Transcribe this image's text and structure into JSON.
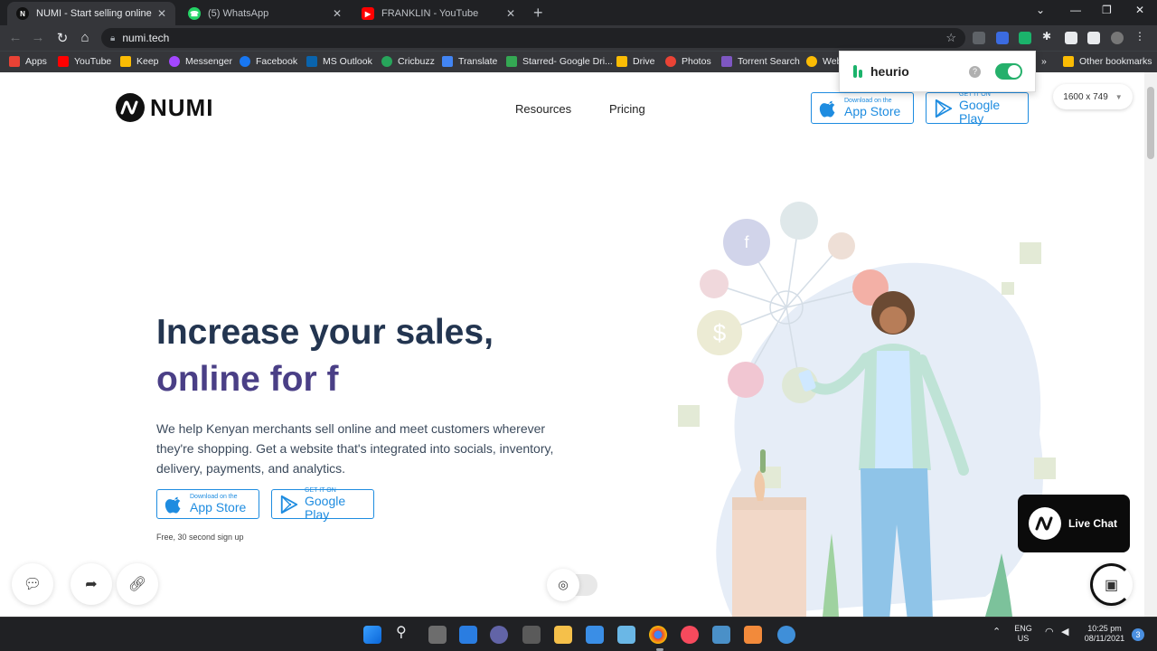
{
  "browser": {
    "tabs": [
      {
        "title": "NUMI - Start selling online for fre",
        "active": true,
        "favicon_color": "#111111"
      },
      {
        "title": "(5) WhatsApp",
        "active": false,
        "favicon_color": "#25d366"
      },
      {
        "title": "FRANKLIN - YouTube",
        "active": false,
        "favicon_color": "#ff0000"
      }
    ],
    "address": "numi.tech",
    "bookmarks": [
      {
        "label": "Apps",
        "color": "#e94235"
      },
      {
        "label": "YouTube",
        "color": "#ff0000"
      },
      {
        "label": "Keep",
        "color": "#fbbc04"
      },
      {
        "label": "Messenger",
        "color": "#a347ff"
      },
      {
        "label": "Facebook",
        "color": "#1877f2"
      },
      {
        "label": "MS Outlook",
        "color": "#0a64ad"
      },
      {
        "label": "Cricbuzz",
        "color": "#27a55b"
      },
      {
        "label": "Translate",
        "color": "#4285f4"
      },
      {
        "label": "Starred- Google Dri...",
        "color": "#34a853"
      },
      {
        "label": "Drive",
        "color": "#fbbc04"
      },
      {
        "label": "Photos",
        "color": "#ea4335"
      },
      {
        "label": "Torrent Search",
        "color": "#7e57c2"
      },
      {
        "label": "Web",
        "color": "#fbbc04"
      }
    ],
    "other_bookmarks": "Other bookmarks",
    "overflow": "»"
  },
  "heurio": {
    "name": "heurio",
    "help": "?",
    "enabled": true
  },
  "viewport": {
    "label": "1600 x 749"
  },
  "site": {
    "logo": "NUMI",
    "nav": [
      "Resources",
      "Pricing"
    ],
    "app_store": {
      "small": "Download on the",
      "big": "App Store"
    },
    "google_play": {
      "small": "GET IT ON",
      "big": "Google Play"
    },
    "hero": {
      "line1": "Increase your sales,",
      "line2": "online for f",
      "description": "We help Kenyan merchants sell online and meet customers wherever they're shopping. Get a website that's integrated into socials, inventory, delivery, payments, and analytics.",
      "signup_note": "Free, 30 second sign up"
    },
    "live_chat": "Live Chat"
  },
  "taskbar": {
    "lang_line1": "ENG",
    "lang_line2": "US",
    "time": "10:25 pm",
    "date": "08/11/2021",
    "notifications": "3"
  },
  "colors": {
    "accent_blue": "#1e8ce0",
    "hero_dark": "#233550",
    "hero_purple": "#4a3f86",
    "heurio_green": "#25b06b"
  }
}
